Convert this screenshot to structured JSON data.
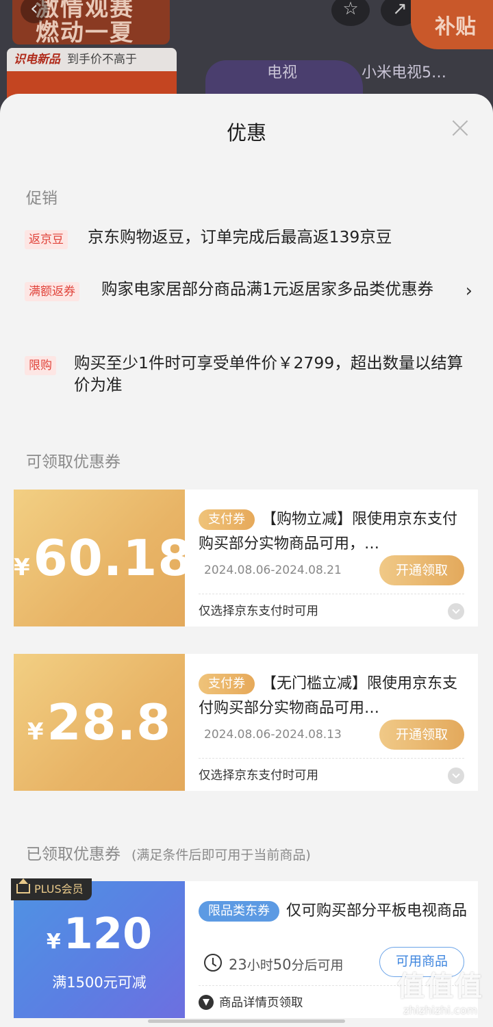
{
  "background": {
    "banner_line1": "激情观赛",
    "banner_line2": "燃动一夏",
    "subsidy": "补贴",
    "tag_brand": "识电新品",
    "tag_text": "到手价不高于",
    "tv_label": "电视",
    "tv_label2": "小米电视5…"
  },
  "sheet": {
    "title": "优惠"
  },
  "promotions": {
    "label": "促销",
    "items": [
      {
        "tag": "返京豆",
        "text": "京东购物返豆，订单完成后最高返139京豆"
      },
      {
        "tag": "满额返券",
        "text": "购家电家居部分商品满1元返居家多品类优惠券",
        "arrow": "›"
      },
      {
        "tag": "限购",
        "text": "购买至少1件时可享受单件价￥2799，超出数量以结算价为准"
      }
    ]
  },
  "available_coupons": {
    "label": "可领取优惠券",
    "items": [
      {
        "currency": "¥",
        "amount": "60.18",
        "badge": "支付券",
        "desc": "【购物立减】限使用京东支付购买部分实物商品可用，…",
        "date": "2024.08.06-2024.08.21",
        "button": "开通领取",
        "note": "仅选择京东支付时可用"
      },
      {
        "currency": "¥",
        "amount": "28.8",
        "badge": "支付券",
        "desc": "【无门槛立减】限使用京东支付购买部分实物商品可用…",
        "date": "2024.08.06-2024.08.13",
        "button": "开通领取",
        "note": "仅选择京东支付时可用"
      }
    ]
  },
  "claimed_coupons": {
    "label": "已领取优惠券",
    "sub": "(满足条件后即可用于当前商品)",
    "items": [
      {
        "plus_badge": "PLUS会员",
        "currency": "¥",
        "amount": "120",
        "condition": "满1500元可减",
        "badge": "限品类东券",
        "desc": "仅可购买部分平板电视商品",
        "timer_num": "23",
        "timer_text1": "小时",
        "timer_num2": "50",
        "timer_text2": "分后可用",
        "button": "可用商品",
        "note": "商品详情页领取"
      }
    ]
  },
  "watermark": {
    "logo": "值值值",
    "site": "zhizhizhi.com"
  },
  "colors": {
    "gold": "#e8b466",
    "blue": "#5b7fe3",
    "tag_red": "#e0433a"
  }
}
